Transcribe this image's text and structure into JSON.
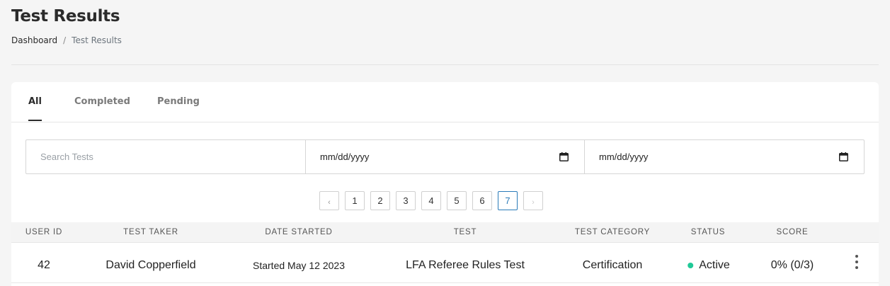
{
  "header": {
    "title": "Test Results",
    "breadcrumb": {
      "home": "Dashboard",
      "separator": "/",
      "current": "Test Results"
    }
  },
  "tabs": [
    {
      "label": "All",
      "active": true
    },
    {
      "label": "Completed",
      "active": false
    },
    {
      "label": "Pending",
      "active": false
    }
  ],
  "filters": {
    "search_placeholder": "Search Tests",
    "date_from_placeholder": "mm/dd/yyyy",
    "date_to_placeholder": "mm/dd/yyyy"
  },
  "pagination": {
    "prev": "‹",
    "next": "›",
    "pages": [
      "1",
      "2",
      "3",
      "4",
      "5",
      "6",
      "7"
    ],
    "current": "7"
  },
  "table": {
    "columns": [
      "USER ID",
      "TEST TAKER",
      "DATE STARTED",
      "TEST",
      "TEST CATEGORY",
      "STATUS",
      "SCORE"
    ],
    "rows": [
      {
        "user_id": "42",
        "test_taker": "David Copperfield",
        "date_started": "Started May 12 2023",
        "test": "LFA Referee Rules Test",
        "test_category": "Certification",
        "status": "Active",
        "score": "0% (0/3)"
      }
    ]
  },
  "colors": {
    "active_status": "#20c997",
    "active_page": "#2b7bb9"
  }
}
